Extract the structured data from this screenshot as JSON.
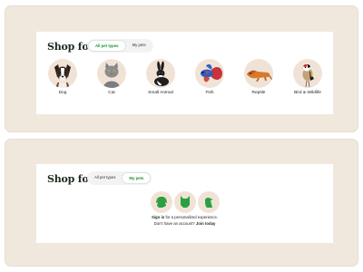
{
  "shop_for_title": "Shop for",
  "tabs": {
    "all": "All pet types",
    "mine": "My pets"
  },
  "pets": [
    {
      "label": "Dog",
      "icon": "dog-icon"
    },
    {
      "label": "Cat",
      "icon": "cat-icon"
    },
    {
      "label": "Small Animal",
      "icon": "rabbit-icon"
    },
    {
      "label": "Fish",
      "icon": "fish-icon"
    },
    {
      "label": "Reptile",
      "icon": "reptile-icon"
    },
    {
      "label": "Bird & Wildlife",
      "icon": "bird-icon"
    }
  ],
  "gate": {
    "sign_in": "Sign in",
    "sign_in_rest": " for a personalized experience.",
    "no_account": "Don't have an account? ",
    "join": "Join today"
  },
  "colors": {
    "accent": "#1f8f34",
    "panel": "#f1e8dd",
    "pet_bg": "#f0e3d6"
  }
}
